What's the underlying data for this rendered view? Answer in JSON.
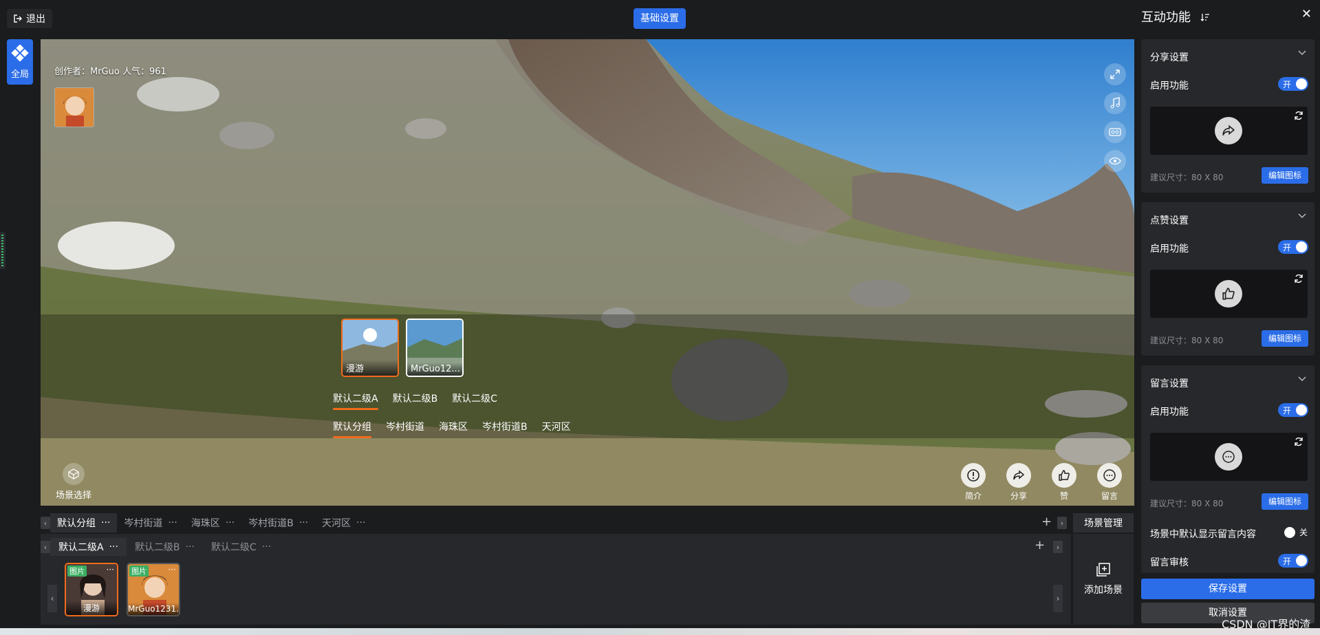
{
  "topbar": {
    "exit_label": "退出",
    "basic_settings_label": "基础设置"
  },
  "rail": {
    "global_label": "全局"
  },
  "scene": {
    "author_text": "创作者：MrGuo    人气：961",
    "thumbnails": [
      {
        "label": "漫游",
        "active": true
      },
      {
        "label": "MrGuo12..."
      }
    ],
    "level2_tabs": [
      "默认二级A",
      "默认二级B",
      "默认二级C"
    ],
    "level1_tabs": [
      "默认分组",
      "岑村街道",
      "海珠区",
      "岑村街道B",
      "天河区"
    ],
    "scene_select_label": "场景选择",
    "actions": [
      {
        "label": "简介",
        "icon": "info-icon"
      },
      {
        "label": "分享",
        "icon": "share-icon"
      },
      {
        "label": "赞",
        "icon": "like-icon"
      },
      {
        "label": "留言",
        "icon": "comment-icon"
      }
    ]
  },
  "manager": {
    "group_tabs": [
      "默认分组",
      "岑村街道",
      "海珠区",
      "岑村街道B",
      "天河区"
    ],
    "sub_tabs": [
      "默认二级A",
      "默认二级B",
      "默认二级C"
    ],
    "title": "场景管理",
    "add_scene_label": "添加场景",
    "scenes": [
      {
        "tag": "图片",
        "name": "漫游",
        "active": true
      },
      {
        "tag": "图片",
        "name": "MrGuo1231..."
      }
    ],
    "more_glyph": "···"
  },
  "right_panel": {
    "title": "互动功能",
    "sections": [
      {
        "title": "分享设置",
        "enable_label": "启用功能",
        "toggle": "开",
        "size_note": "建议尺寸：80 X 80",
        "edit_label": "编辑图标"
      },
      {
        "title": "点赞设置",
        "enable_label": "启用功能",
        "toggle": "开",
        "size_note": "建议尺寸：80 X 80",
        "edit_label": "编辑图标"
      },
      {
        "title": "留言设置",
        "enable_label": "启用功能",
        "toggle": "开",
        "size_note": "建议尺寸：80 X 80",
        "edit_label": "编辑图标"
      }
    ],
    "default_show_label": "场景中默认显示留言内容",
    "default_show_toggle": "关",
    "review_label": "留言审核",
    "review_toggle": "开",
    "save_label": "保存设置",
    "cancel_label": "取消设置"
  },
  "watermark": "CSDN @IT界的渣"
}
